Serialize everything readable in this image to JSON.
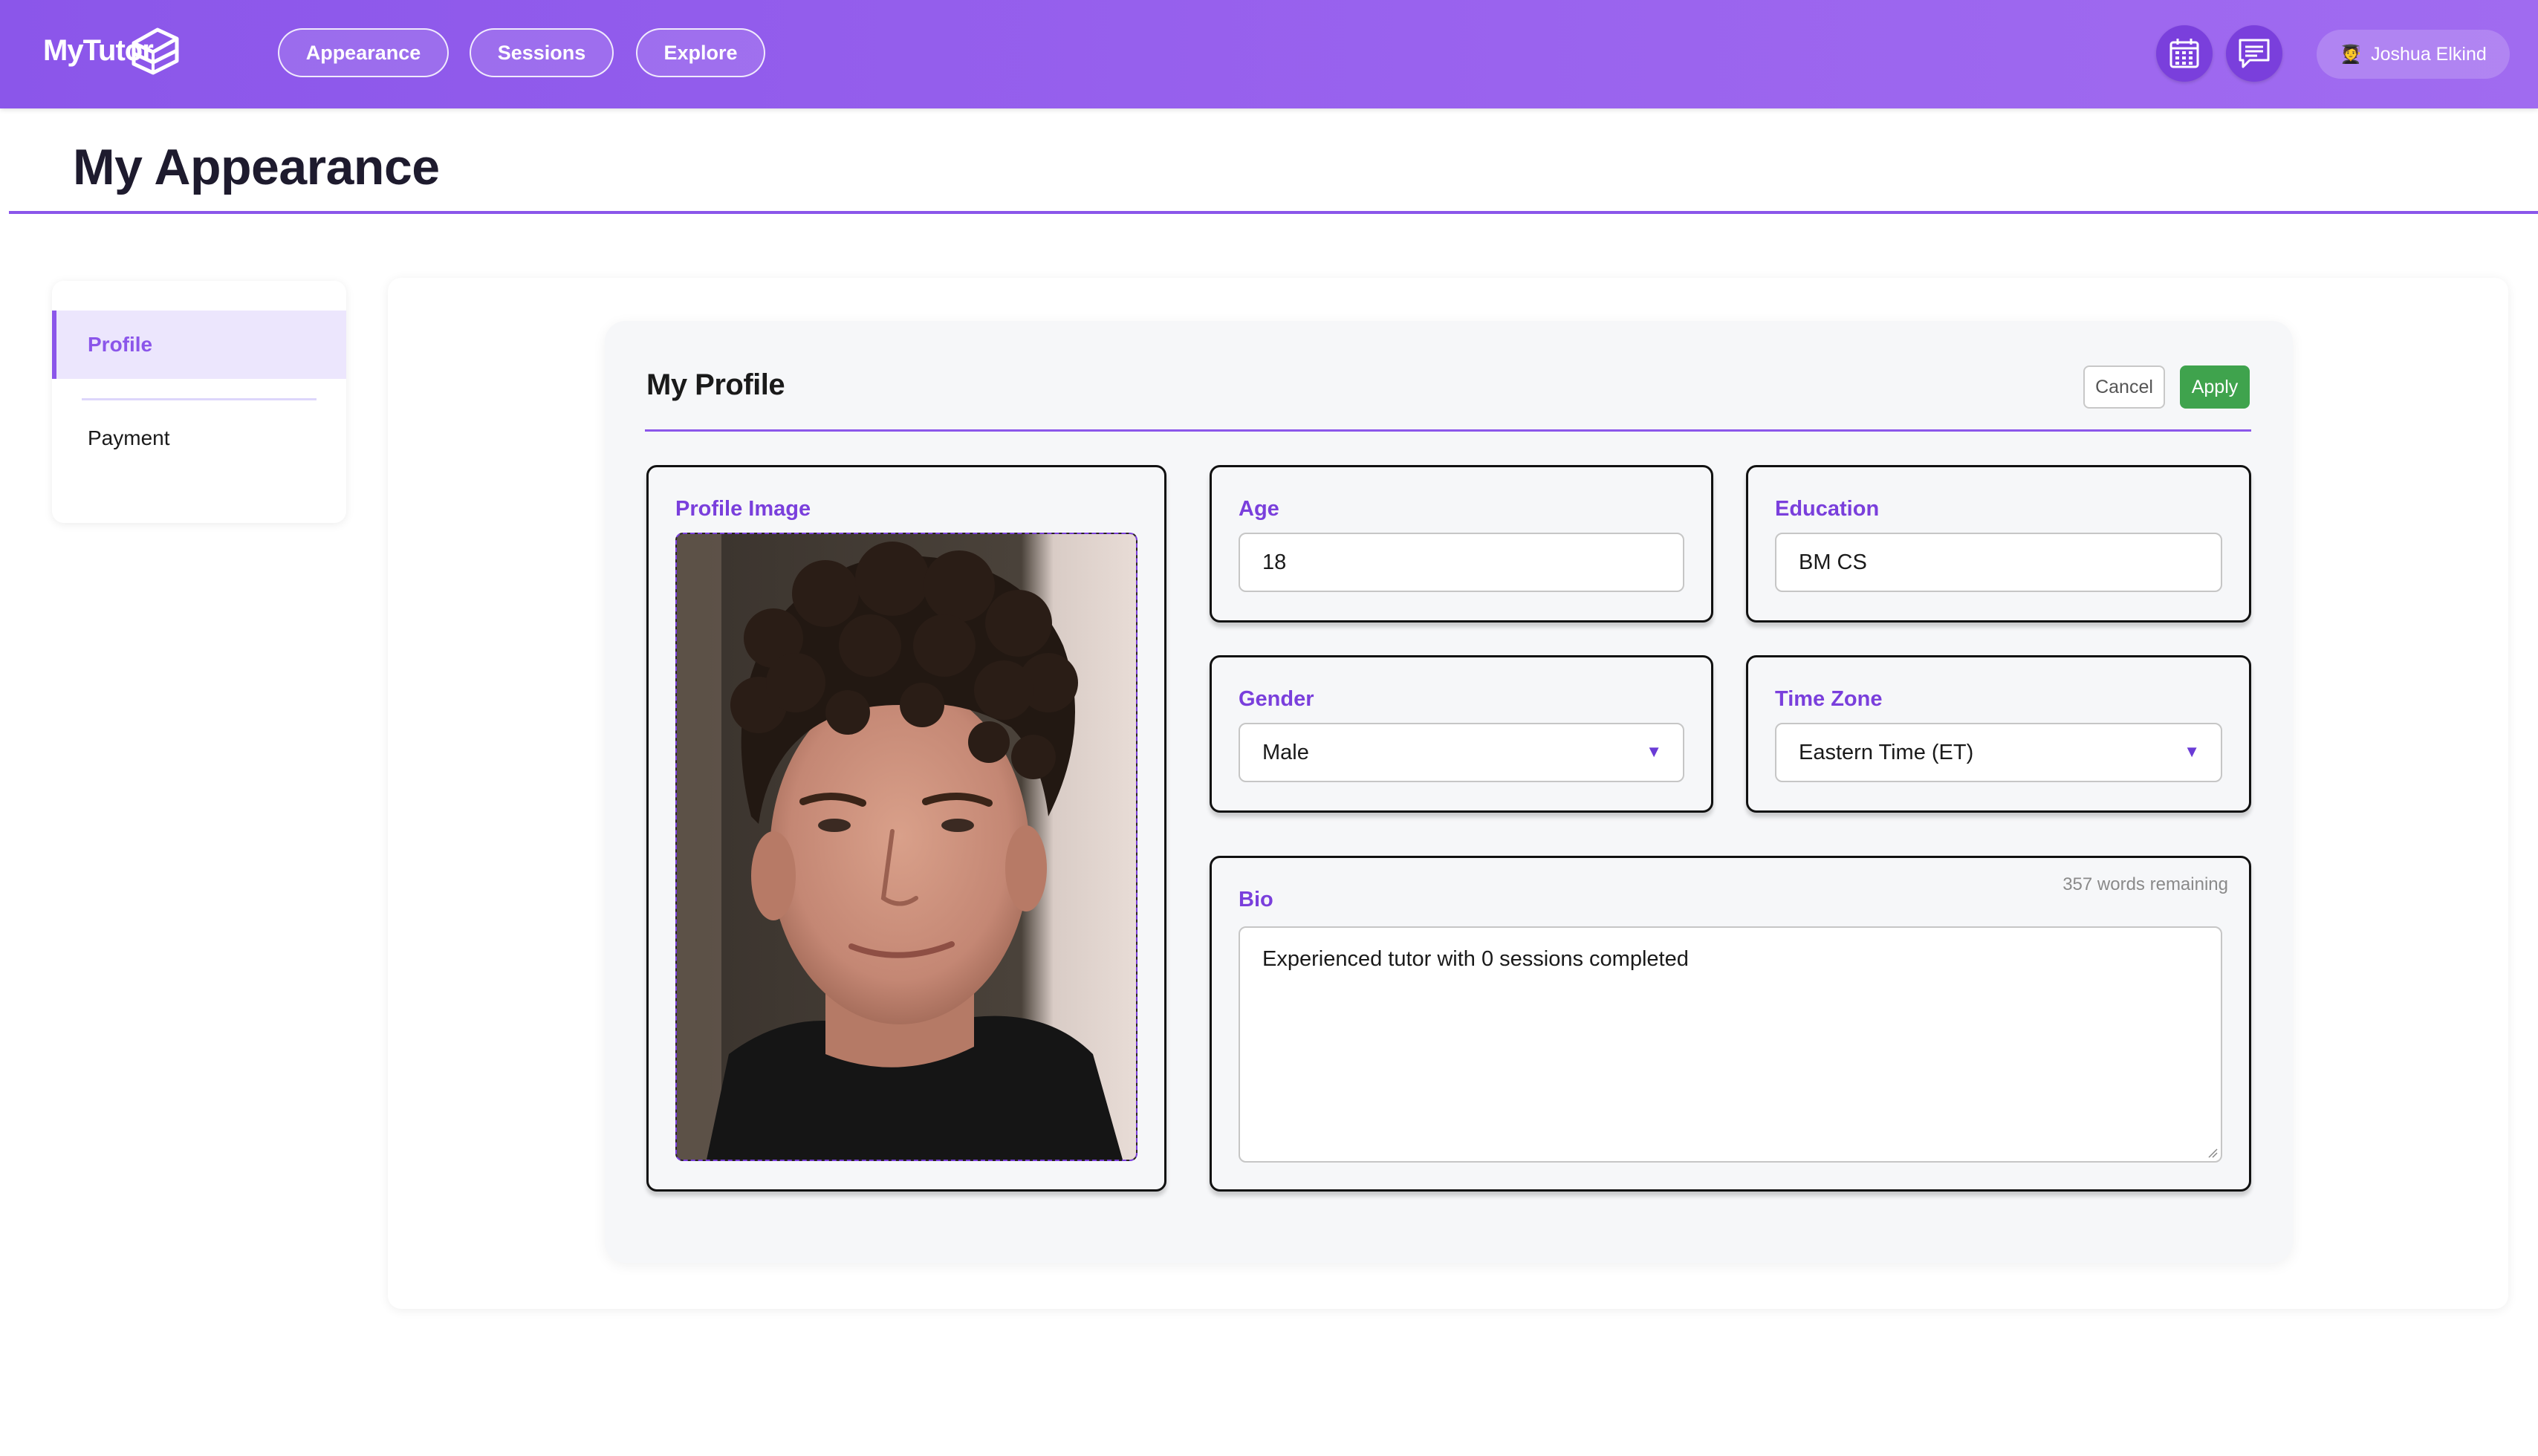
{
  "app": {
    "brand": "MyTutor"
  },
  "nav": {
    "appearance": "Appearance",
    "sessions": "Sessions",
    "explore": "Explore"
  },
  "header_icons": [
    "calendar-icon",
    "chat-icon"
  ],
  "user": {
    "name": "Joshua Elkind",
    "avatar_emoji": "🧑‍🎓"
  },
  "page": {
    "title": "My Appearance"
  },
  "sidebar": {
    "items": [
      {
        "label": "Profile",
        "active": true
      },
      {
        "label": "Payment",
        "active": false
      }
    ]
  },
  "profile": {
    "title": "My Profile",
    "cancel_label": "Cancel",
    "apply_label": "Apply",
    "image_label": "Profile Image",
    "age": {
      "label": "Age",
      "value": "18"
    },
    "education": {
      "label": "Education",
      "value": "BM CS"
    },
    "gender": {
      "label": "Gender",
      "value": "Male"
    },
    "timezone": {
      "label": "Time Zone",
      "value": "Eastern Time (ET)"
    },
    "bio": {
      "label": "Bio",
      "value": "Experienced tutor with 0 sessions completed",
      "words_remaining": "357 words remaining"
    }
  },
  "colors": {
    "accent": "#8b56ea",
    "label": "#7a3fdc",
    "apply": "#3fa34d"
  }
}
